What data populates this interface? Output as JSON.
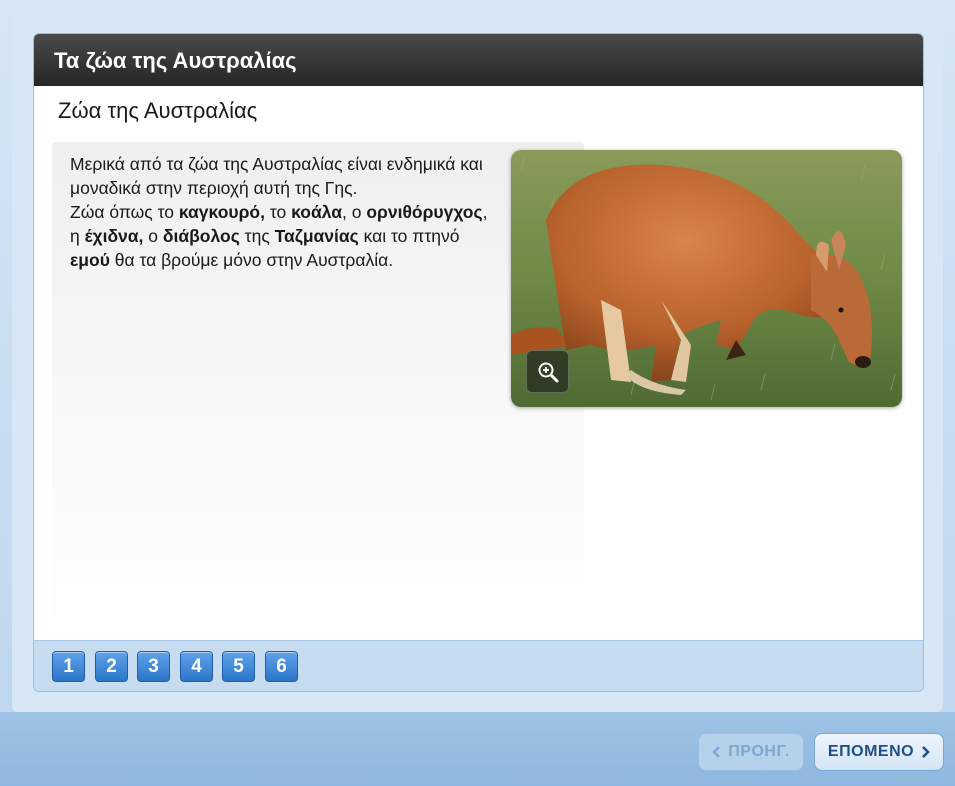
{
  "header": {
    "title": "Τα ζώα της Αυστραλίας"
  },
  "page": {
    "title": "Ζώα της Αυστραλίας"
  },
  "content": {
    "intro": "Μερικά από τα ζώα της Αυστραλίας είναι ενδημικά και μοναδικά στην περιοχή αυτή της Γης.",
    "p1": "Ζώα όπως το ",
    "kangaroo": "καγκουρό,",
    "p2": " το ",
    "koala": "κοάλα",
    "p3": ", ο ",
    "platypus": "ορνιθόρυγχος",
    "p4": ", η ",
    "echidna": "έχιδνα,",
    "p5": " ο ",
    "devil": "διάβολος",
    "p6": " της ",
    "tasmania": "Ταζμανίας",
    "p7": " και το πτηνό ",
    "emu": "εμού",
    "p8": " θα τα βρούμε μόνο στην Αυστραλία."
  },
  "image": {
    "icon": "zoom-in-icon"
  },
  "pager": {
    "pages": [
      "1",
      "2",
      "3",
      "4",
      "5",
      "6"
    ]
  },
  "nav": {
    "prev_label": "ΠΡΟΗΓ.",
    "next_label": "ΕΠΟΜΕΝΟ"
  },
  "colors": {
    "header_bg": "#2e2e2e",
    "accent": "#2c76c9",
    "frame": "#c9def1"
  }
}
